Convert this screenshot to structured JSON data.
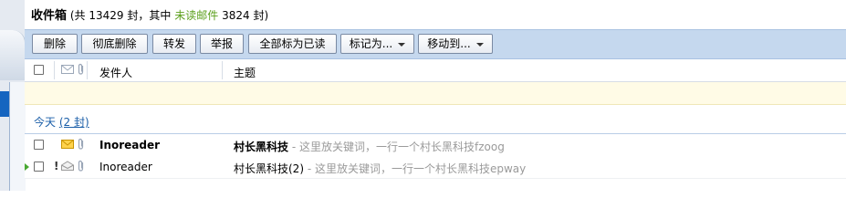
{
  "inbox": {
    "name": "收件箱",
    "total_prefix": "(共",
    "total": "13429",
    "total_unit": "封，其中",
    "unread_label": "未读邮件",
    "unread": "3824",
    "unread_unit": "封)"
  },
  "toolbar": {
    "delete": "删除",
    "delete_permanently": "彻底删除",
    "forward": "转发",
    "report": "举报",
    "mark_all_read": "全部标为已读",
    "mark_as": "标记为...",
    "move_to": "移动到..."
  },
  "header": {
    "sender": "发件人",
    "subject": "主题"
  },
  "group": {
    "label": "今天",
    "count": "(2 封)"
  },
  "emails": [
    {
      "sender": "Inoreader",
      "subject": "村长黑科技",
      "preview": "- 这里放关键词，一行一个村长黑科技fzoog",
      "read": false,
      "icon": "envelope-unread-icon"
    },
    {
      "sender": "Inoreader",
      "subject": "村长黑科技(2)",
      "preview": "- 这里放关键词，一行一个村长黑科技epway",
      "read": true,
      "icon": "envelope-read-icon"
    }
  ],
  "colors": {
    "toolbar_bg": "#c5d8ee",
    "unread_green": "#5b9f1b",
    "link_blue": "#1a5ea8",
    "banner_yellow": "#fffbe6"
  }
}
